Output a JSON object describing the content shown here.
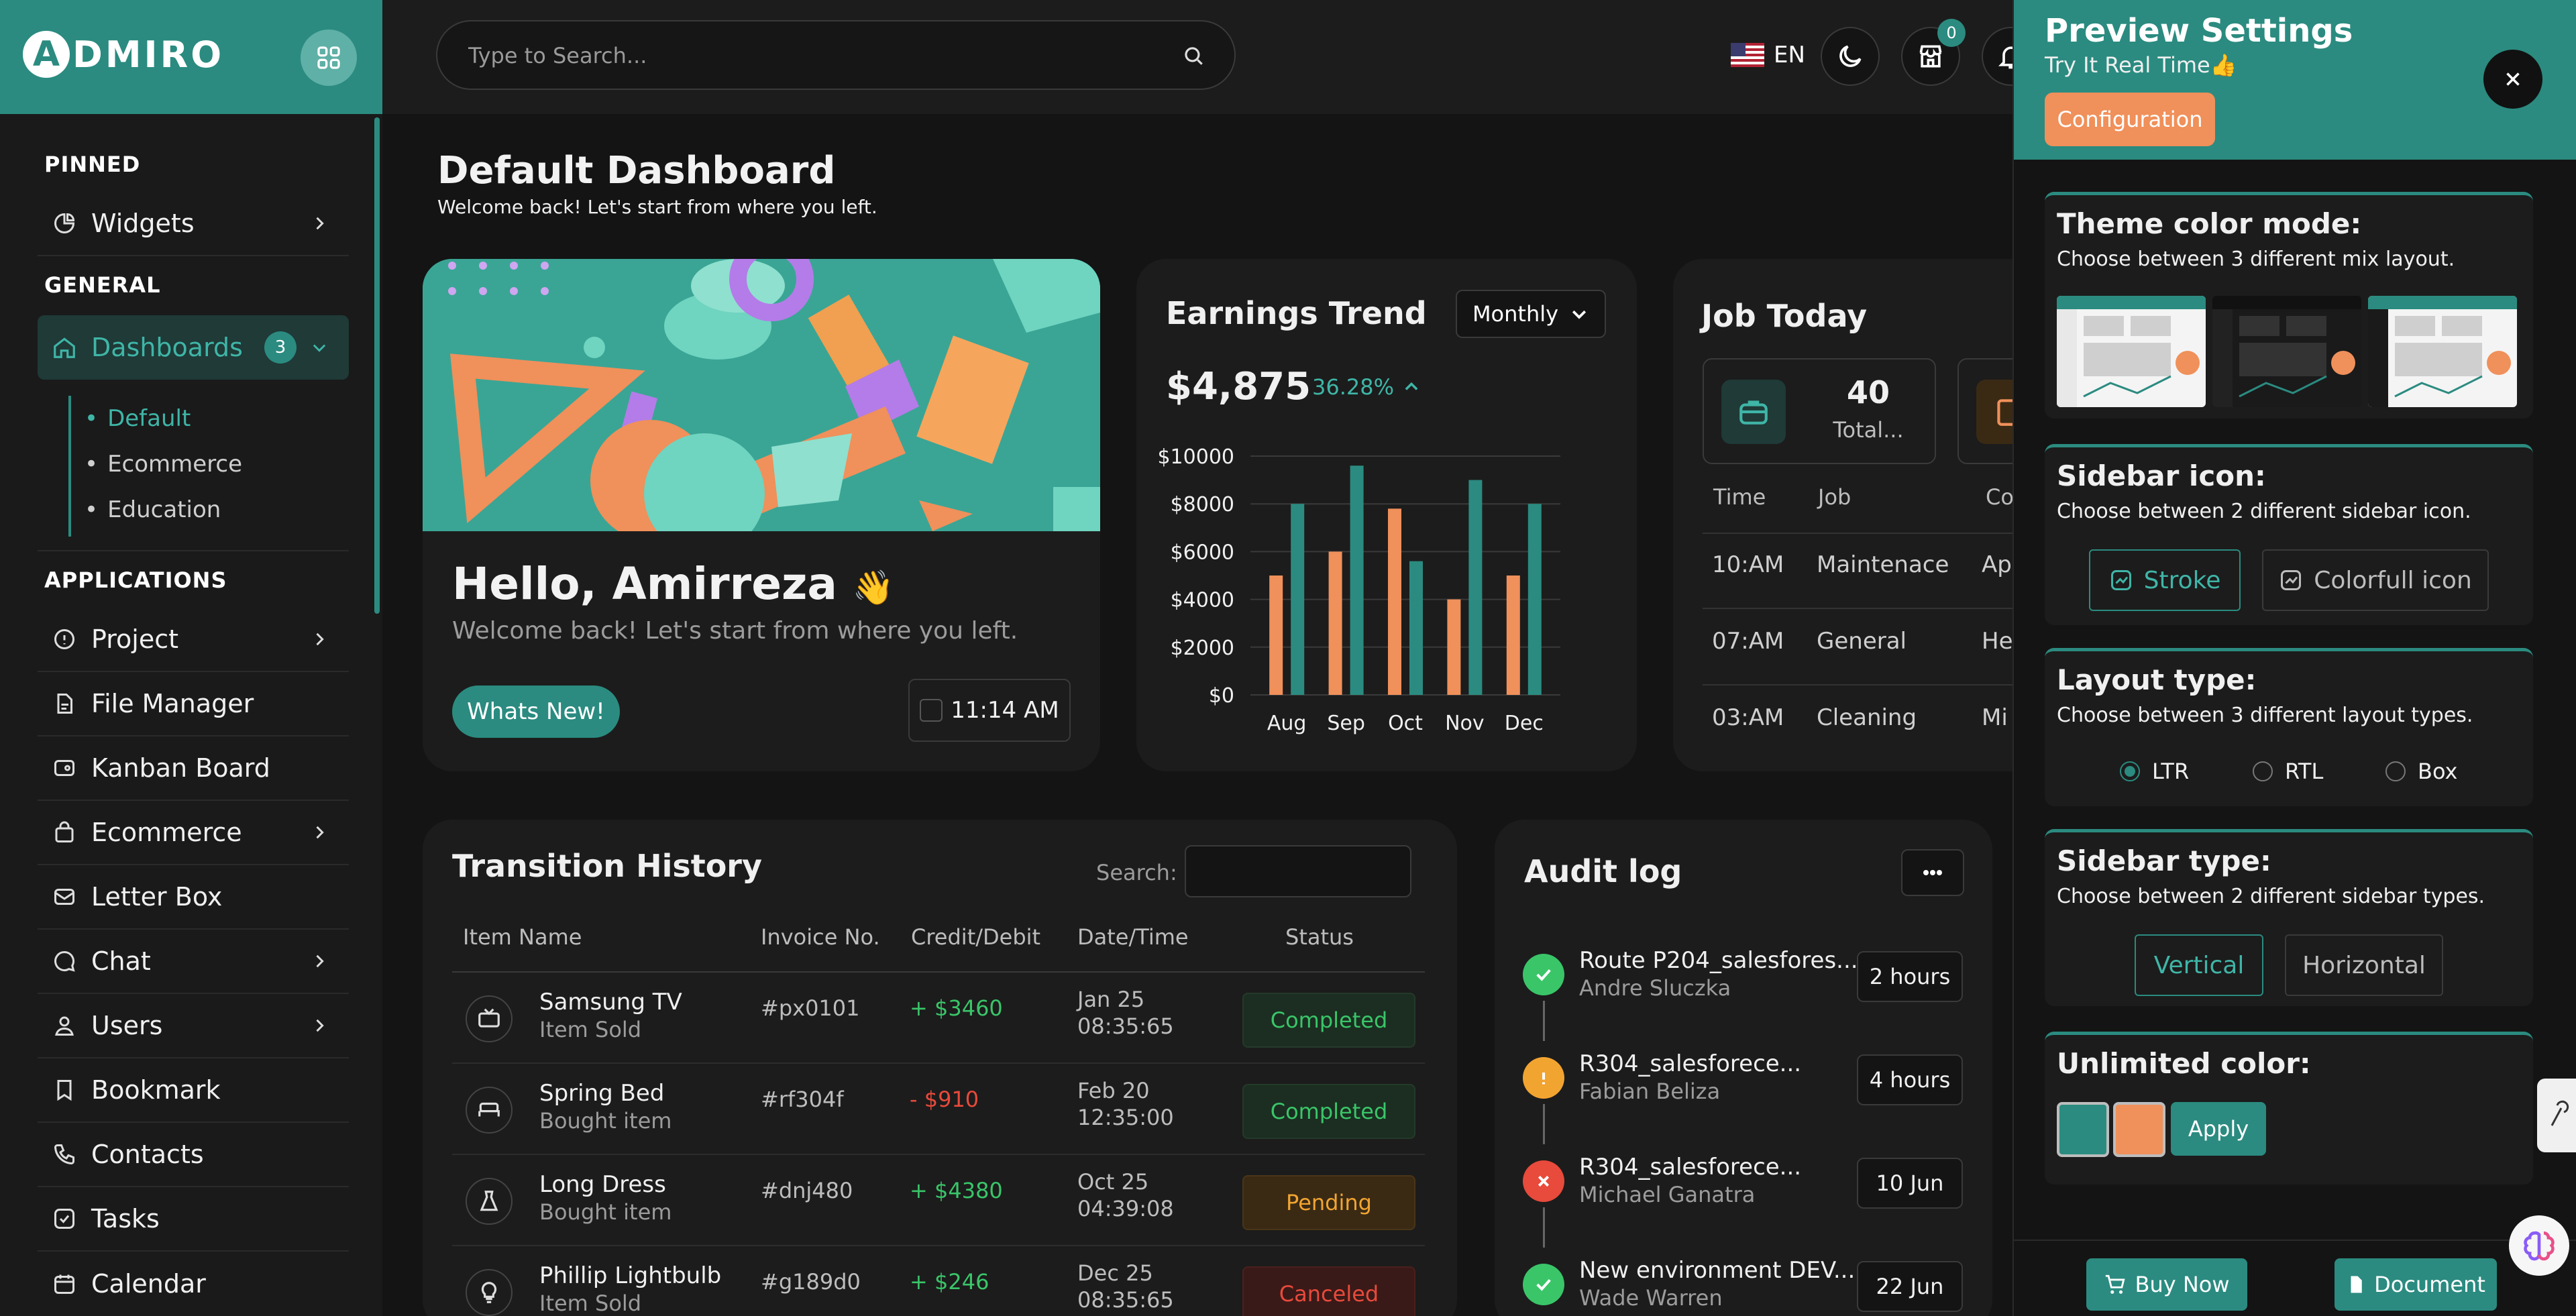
{
  "app": {
    "logo_letter": "A",
    "logo_text": "DMIRO"
  },
  "search": {
    "placeholder": "Type to Search..."
  },
  "topbar": {
    "lang": "EN",
    "cart_count": "0"
  },
  "sidebar": {
    "sections": {
      "pinned": "PINNED",
      "general": "GENERAL",
      "applications": "APPLICATIONS"
    },
    "widgets": "Widgets",
    "dashboards": {
      "label": "Dashboards",
      "badge": "3"
    },
    "sub_items": [
      "Default",
      "Ecommerce",
      "Education"
    ],
    "apps": [
      "Project",
      "File Manager",
      "Kanban Board",
      "Ecommerce",
      "Letter Box",
      "Chat",
      "Users",
      "Bookmark",
      "Contacts",
      "Tasks",
      "Calendar"
    ]
  },
  "page": {
    "title": "Default Dashboard",
    "subtitle": "Welcome back! Let's start from where you left."
  },
  "welcome": {
    "hello": "Hello, Amirreza",
    "wave": "👋",
    "subtitle": "Welcome back! Let's start from where you left.",
    "button": "Whats New!",
    "time": "11:14 AM"
  },
  "earnings": {
    "title": "Earnings Trend",
    "period": "Monthly",
    "value": "$4,875",
    "change": "36.28%"
  },
  "chart_data": {
    "type": "bar",
    "categories": [
      "Aug",
      "Sep",
      "Oct",
      "Nov",
      "Dec"
    ],
    "series": [
      {
        "values": [
          5000,
          6000,
          7800,
          4000,
          5000
        ],
        "color": "#f0905a"
      },
      {
        "values": [
          8000,
          9600,
          5600,
          9000,
          8000
        ],
        "color": "#2b8b80"
      }
    ],
    "ylim": [
      0,
      10000
    ],
    "yticks": [
      "$0",
      "$2000",
      "$4000",
      "$6000",
      "$8000",
      "$10000"
    ],
    "grid": true
  },
  "job": {
    "title": "Job Today",
    "total": "40",
    "total_label": "Total...",
    "headers": [
      "Time",
      "Job",
      "Co"
    ],
    "rows": [
      {
        "time": "10:AM",
        "job": "Maintenace",
        "co": "Ap"
      },
      {
        "time": "07:AM",
        "job": "General",
        "co": "He"
      },
      {
        "time": "03:AM",
        "job": "Cleaning",
        "co": "Mi"
      }
    ]
  },
  "transactions": {
    "title": "Transition History",
    "search_label": "Search:",
    "headers": [
      "Item Name",
      "Invoice No.",
      "Credit/Debit",
      "Date/Time",
      "Status"
    ],
    "rows": [
      {
        "name": "Samsung TV",
        "sub": "Item Sold",
        "inv": "#px0101",
        "amt": "+ $3460",
        "date": "Jan 25",
        "time": "08:35:65",
        "status": "Completed"
      },
      {
        "name": "Spring Bed",
        "sub": "Bought item",
        "inv": "#rf304f",
        "amt": "- $910",
        "date": "Feb 20",
        "time": "12:35:00",
        "status": "Completed"
      },
      {
        "name": "Long Dress",
        "sub": "Bought item",
        "inv": "#dnj480",
        "amt": "+ $4380",
        "date": "Oct 25",
        "time": "04:39:08",
        "status": "Pending"
      },
      {
        "name": "Phillip Lightbulb",
        "sub": "Item Sold",
        "inv": "#g189d0",
        "amt": "+ $246",
        "date": "Dec 25",
        "time": "08:35:65",
        "status": "Canceled"
      }
    ]
  },
  "audit": {
    "title": "Audit log",
    "items": [
      {
        "title": "Route P204_salesfores...",
        "sub": "Andre Sluczka",
        "badge": "2 hours",
        "color": "#3ac569"
      },
      {
        "title": "R304_salesforece...",
        "sub": "Fabian Beliza",
        "badge": "4 hours",
        "color": "#f2a431"
      },
      {
        "title": "R304_salesforece...",
        "sub": "Michael Ganatra",
        "badge": "10 Jun",
        "color": "#e84a3b"
      },
      {
        "title": "New environment DEV...",
        "sub": "Wade Warren",
        "badge": "22 Jun",
        "color": "#3ac569"
      }
    ]
  },
  "settings": {
    "title": "Preview Settings",
    "subtitle": "Try It Real Time",
    "config": "Configuration",
    "theme": {
      "title": "Theme color mode:",
      "sub": "Choose between 3 different mix layout."
    },
    "sidebar_icon": {
      "title": "Sidebar icon:",
      "sub": "Choose between 2 different sidebar icon.",
      "opt1": "Stroke",
      "opt2": "Colorfull icon"
    },
    "layout": {
      "title": "Layout type:",
      "sub": "Choose between 3 different layout types.",
      "opts": [
        "LTR",
        "RTL",
        "Box"
      ]
    },
    "sidebar_type": {
      "title": "Sidebar type:",
      "sub": "Choose between 2 different sidebar types.",
      "opt1": "Vertical",
      "opt2": "Horizontal"
    },
    "color": {
      "title": "Unlimited color:",
      "apply": "Apply",
      "primary": "#2b8b80",
      "secondary": "#f0905a"
    },
    "buy": "Buy Now",
    "document": "Document"
  }
}
